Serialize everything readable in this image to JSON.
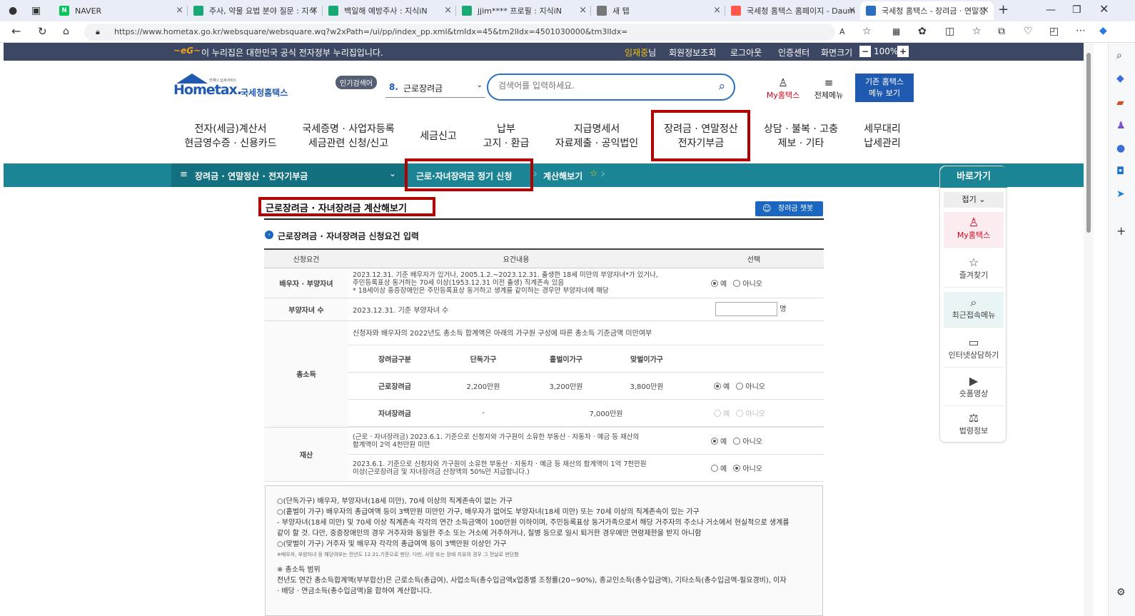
{
  "browser": {
    "tabs": [
      {
        "title": "NAVER",
        "fav": "N",
        "color": "#03c75a"
      },
      {
        "title": "주사, 약물 요법 분야 질문 : 지식",
        "fav": "",
        "color": "#19a974"
      },
      {
        "title": "백일해 예방주사 : 지식iN",
        "fav": "",
        "color": "#19a974"
      },
      {
        "title": "jjim**** 프로필 : 지식iN",
        "fav": "",
        "color": "#19a974"
      },
      {
        "title": "새 탭",
        "fav": "",
        "color": "#777777"
      },
      {
        "title": "국세청 홈택스 홈페이지 - Daum",
        "fav": "",
        "color": "#ff5a4a"
      },
      {
        "title": "국세청 홈택스 - 장려금 · 연말정",
        "fav": "",
        "color": "#2b6fc1"
      }
    ],
    "url": "https://www.hometax.go.kr/websquare/websquare.wq?w2xPath=/ui/pp/index_pp.xml&tmIdx=45&tm2lIdx=4501030000&tm3lIdx="
  },
  "gov": {
    "notice": "이 누리집은 대한민국 공식 전자정부 누리집입니다.",
    "user": "임재중",
    "user_suffix": "님",
    "links": [
      "회원정보조회",
      "로그아웃",
      "인증센터",
      "화면크기"
    ],
    "zoom": "100%"
  },
  "header": {
    "logo": "Hometax.",
    "logo_sub": "국세청홈택스",
    "logo_tag": "언제나 납세서비스",
    "popular": "인기검색어",
    "popular_rank": "8.",
    "popular_term": "근로장려금",
    "search_placeholder": "검색어를 입력하세요.",
    "my": "My홈택스",
    "all_menu": "전체메뉴",
    "legacy_btn_1": "기존 홈택스",
    "legacy_btn_2": "메뉴 보기"
  },
  "gnb": [
    [
      "전자(세금)계산서",
      "현금영수증 · 신용카드"
    ],
    [
      "국세증명 · 사업자등록",
      "세금관련 신청/신고"
    ],
    [
      "세금신고"
    ],
    [
      "납부",
      "고지 · 환급"
    ],
    [
      "지급명세서",
      "자료제출 · 공익법인"
    ],
    [
      "장려금 · 연말정산",
      "전자기부금"
    ],
    [
      "상담 · 불복 · 고충",
      "제보 · 기타"
    ],
    [
      "세무대리",
      "납세관리"
    ]
  ],
  "breadcrumb": {
    "menu": "장려금 · 연말정산 · 전자기부금",
    "sub": "근로·자녀장려금 정기 신청",
    "current": "계산해보기"
  },
  "page": {
    "title": "근로장려금 · 자녀장려금 계산해보기",
    "chatbot": "장려금 챗봇",
    "section": "근로장려금 · 자녀장려금 신청요건 입력"
  },
  "table": {
    "headers": [
      "신청요건",
      "요건내용",
      "선택"
    ],
    "yes": "예",
    "no": "아니오",
    "row1": {
      "label": "배우자 · 부양자녀",
      "l1": "2023.12.31. 기준 배우자가 있거나, 2005.1.2.~2023.12.31. 출생한 18세 미만의 부양자녀*가 있거나,",
      "l2": "주민등록표상 동거하는 70세 이상(1953.12.31 이전 출생) 직계존속 있음",
      "l3": "* 18세이상 중증장애인은 주민등록표상 동거하고 생계를 같이하는 경우만 부양자녀에 해당"
    },
    "row2": {
      "label": "부양자녀 수",
      "text": "2023.12.31. 기준 부양자녀 수",
      "unit": "명"
    },
    "row3": {
      "label": "총소득",
      "intro": "신청자와 배우자의 2022년도 총소득 합계액은 아래의 가구원 구성에 따른 총소득 기준금액 미만여부",
      "sub_headers": [
        "장려금구분",
        "단독가구",
        "홑벌이가구",
        "맞벌이가구"
      ],
      "work": [
        "근로장려금",
        "2,200만원",
        "3,200만원",
        "3,800만원"
      ],
      "child": [
        "자녀장려금",
        "-",
        "7,000만원"
      ]
    },
    "row4": {
      "label": "재산",
      "a1": "(근로 · 자녀장려금) 2023.6.1. 기준으로 신청자와 가구원이 소유한 부동산 · 자동차 · 예금 등 재산의",
      "a2": "합계액이 2억 4천만원 미만",
      "b1": "2023.6.1. 기준으로 신청자와 가구원이 소유한 부동산 · 자동차 · 예금 등 재산의 합계액이 1억 7천만원",
      "b2": "이상(근로장려금 및 자녀장려금 산정액의 50%만 지급합니다.)"
    }
  },
  "notes": [
    "○(단독가구) 배우자, 부양자녀(18세 미만), 70세 이상의 직계존속이 없는 가구",
    "○(홑벌이 가구) 배우자의 총급여액 등이 3백만원 미만인 가구, 배우자가 없어도 부양자녀(18세 미만) 또는 70세 이상의 직계존속이 있는 가구",
    "- 부양자녀(18세 미만) 및 70세 이상 직계존속 각각의 연간 소득금액이 100만원 이하이며, 주민등록표상 동거가족으로서 해당 거주자의 주소나 거소에서 현실적으로 생계를",
    "같이 할 것. 다만, 중증장애인의 경우 거주자와 동일한 주소 또는 거소에 거주하거나, 질병 등으로 일시 퇴거한 경우에만 연령제한을 받지 아니함",
    "○(맞벌이 가구) 거주자 및 배우자 각각의 총급여액 등이 3백만원 이상인 가구",
    "※배우자, 부양자녀 등 해당여부는 전년도 12.31.기준으로 판단. 다만, 사망 또는 장애 치유의 경우 그 전날로 판단함",
    "※ 총소득 범위",
    "전년도 연간 총소득합계액(부부합산)은 근로소득(총급여), 사업소득(총수입금액x업종별 조정률(20~90%), 종교인소득(총수입금액), 기타소득(총수입금액-필요경비), 이자",
    "· 배당 · 연금소득(총수입금액)을 합하여 계산합니다."
  ],
  "quick": {
    "title": "바로가기",
    "fold": "접기",
    "items": [
      "My홈택스",
      "즐겨찾기",
      "최근접속메뉴",
      "인터넷상담하기",
      "숏폼영상",
      "법령정보"
    ]
  }
}
